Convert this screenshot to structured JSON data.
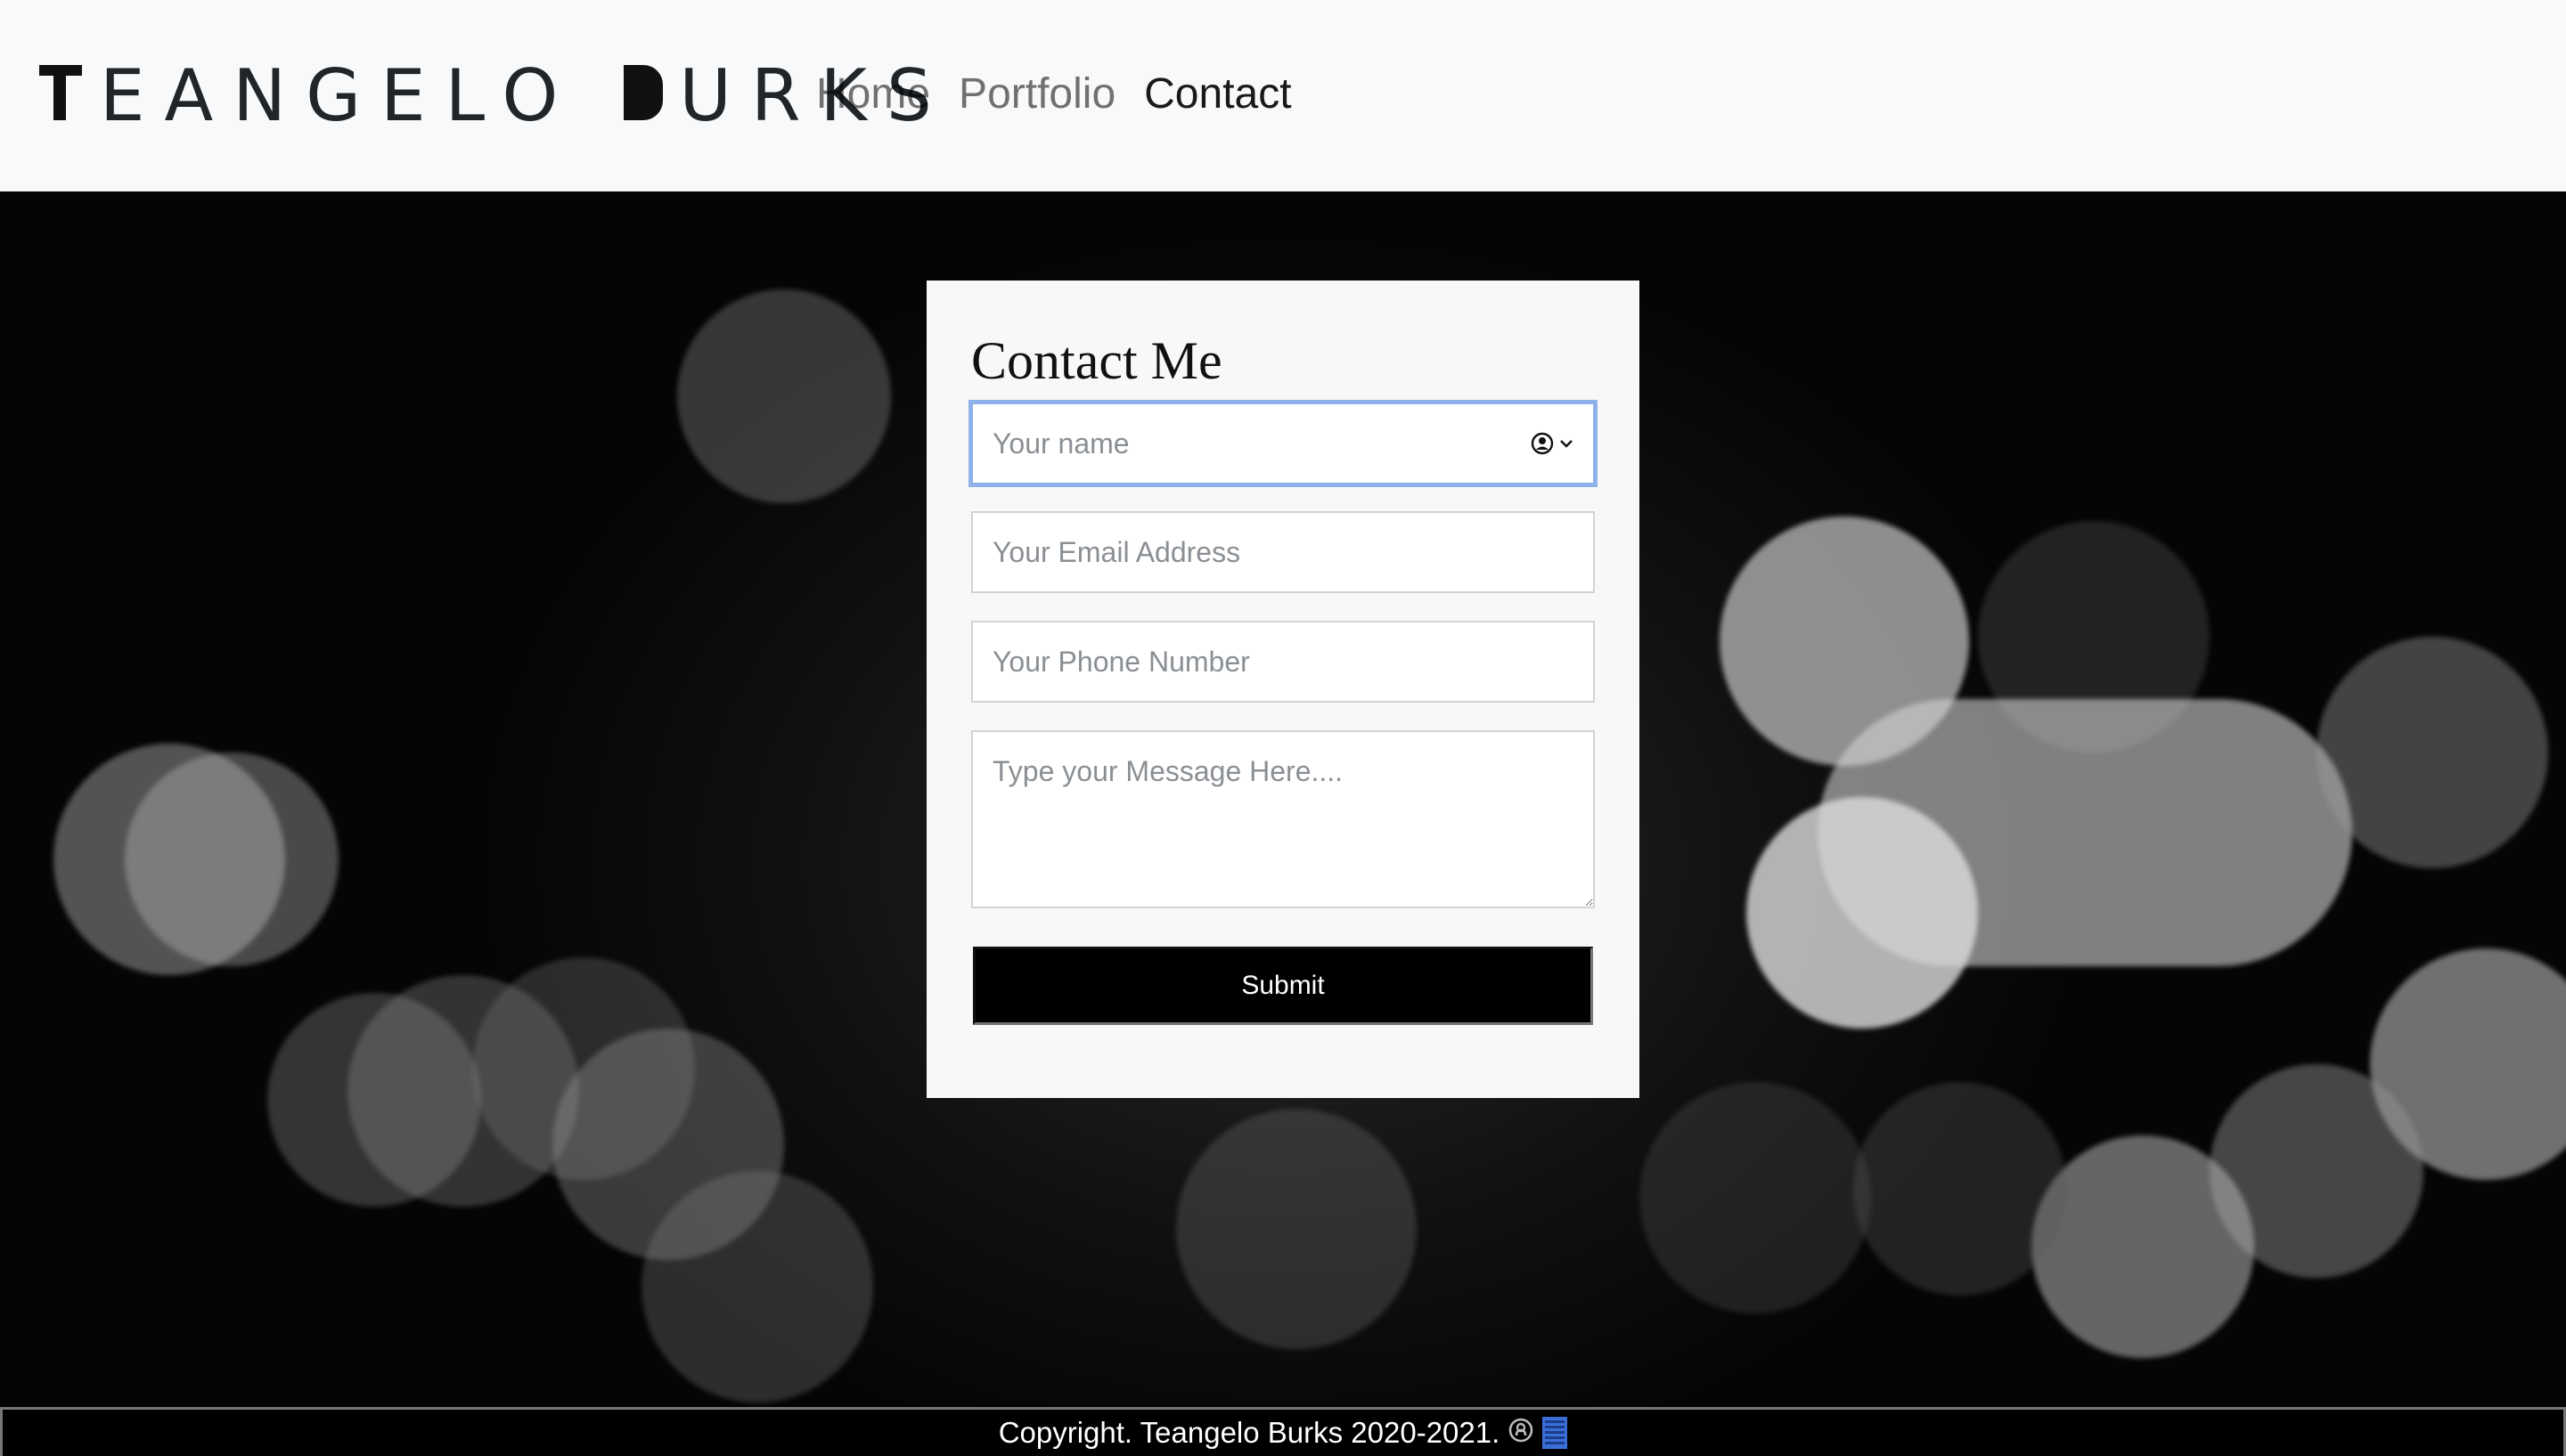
{
  "brand": {
    "first_rest": "EANGELO",
    "last_rest": "URKS"
  },
  "nav": {
    "home": "Home",
    "portfolio": "Portfolio",
    "contact": "Contact"
  },
  "form": {
    "title": "Contact Me",
    "name_placeholder": "Your name",
    "email_placeholder": "Your Email Address",
    "phone_placeholder": "Your Phone Number",
    "message_placeholder": "Type your Message Here....",
    "submit_label": "Submit"
  },
  "footer": {
    "copyright": "Copyright. Teangelo Burks 2020-2021."
  },
  "colors": {
    "navbar_bg": "#f8f9fa",
    "card_bg": "#f8f8f8",
    "focus_ring": "#8fb1ea",
    "button_bg": "#000000",
    "footer_bg": "#000000",
    "link_icon": "#3b6fd8"
  },
  "icons": [
    "contact-autofill-icon",
    "chevron-down-icon",
    "github-icon",
    "linkedin-icon"
  ]
}
